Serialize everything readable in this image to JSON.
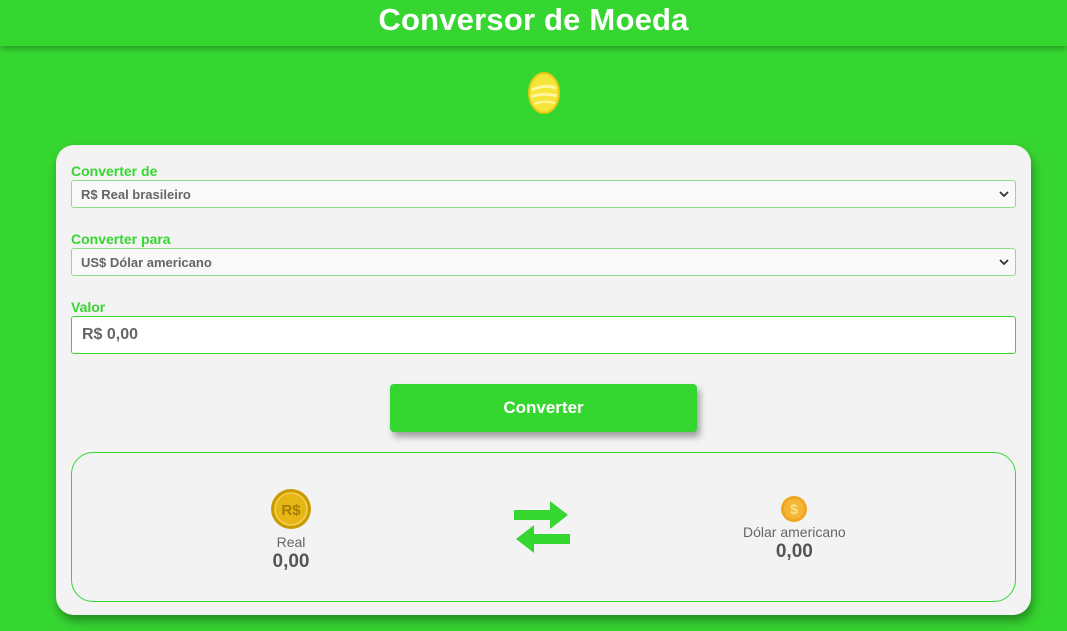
{
  "header": {
    "title": "Conversor de Moeda"
  },
  "form": {
    "from_label": "Converter de",
    "from_value": "R$ Real brasileiro",
    "to_label": "Converter para",
    "to_value": "US$ Dólar americano",
    "amount_label": "Valor",
    "amount_value": "R$ 0,00",
    "convert_button": "Converter"
  },
  "result": {
    "source": {
      "currency_name": "Real",
      "amount": "0,00",
      "icon": "real-coin-icon"
    },
    "target": {
      "currency_name": "Dólar americano",
      "amount": "0,00",
      "icon": "dollar-coin-icon"
    },
    "swap_icon": "swap-arrows-icon"
  },
  "colors": {
    "accent": "#36d631",
    "card": "#f3f3f3",
    "text_muted": "#666666"
  }
}
